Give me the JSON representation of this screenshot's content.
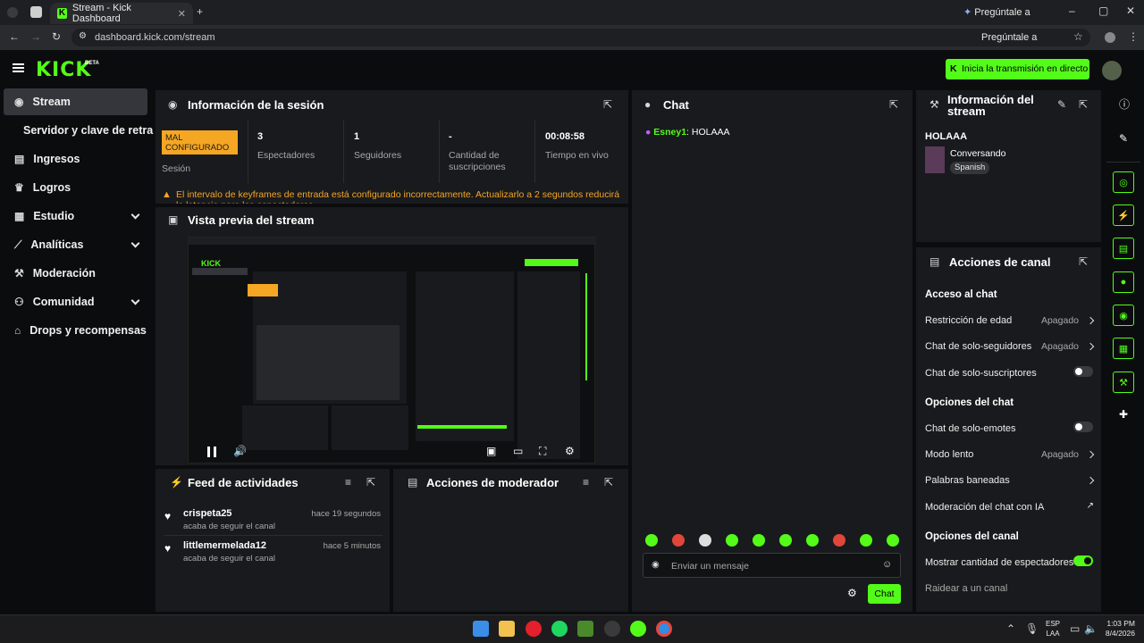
{
  "browser": {
    "tab_title": "Stream - Kick Dashboard",
    "url": "dashboard.kick.com/stream",
    "gemini_label": "Pregúntale a Gemini",
    "google_label": "Pregúntale a Google"
  },
  "header": {
    "logo": "KICK",
    "beta": "BETA",
    "go_live_label": "Inicia la transmisión en directo"
  },
  "sidebar": {
    "items": [
      {
        "label": "Stream"
      },
      {
        "label": "Servidor y clave de retransm"
      },
      {
        "label": "Ingresos"
      },
      {
        "label": "Logros"
      },
      {
        "label": "Estudio"
      },
      {
        "label": "Analíticas"
      },
      {
        "label": "Moderación"
      },
      {
        "label": "Comunidad"
      },
      {
        "label": "Drops y recompensas"
      }
    ]
  },
  "session": {
    "title": "Información de la sesión",
    "status_badge": "MAL CONFIGURADO",
    "status_label": "Sesión",
    "viewers_value": "3",
    "viewers_label": "Espectadores",
    "followers_value": "1",
    "followers_label": "Seguidores",
    "subs_value": "-",
    "subs_label": "Cantidad de suscripciones",
    "uptime_value": "00:08:58",
    "uptime_label": "Tiempo en vivo",
    "warning": "El intervalo de keyframes de entrada está configurado incorrectamente. Actualizarlo a 2 segundos reducirá la latencia para los espectadores."
  },
  "preview": {
    "title": "Vista previa del stream"
  },
  "activity": {
    "title": "Feed de actividades",
    "items": [
      {
        "user": "crispeta25",
        "time": "hace 19 segundos",
        "desc": "acaba de seguir el canal"
      },
      {
        "user": "littlemermelada12",
        "time": "hace 5 minutos",
        "desc": "acaba de seguir el canal"
      }
    ]
  },
  "mod_actions": {
    "title": "Acciones de moderador"
  },
  "chat": {
    "title": "Chat",
    "messages": [
      {
        "user": "Esney1",
        "sep": ":",
        "text": "HOLAAA"
      }
    ],
    "input_placeholder": "Enviar un mensaje",
    "send_label": "Chat"
  },
  "stream_info": {
    "title": "Información del stream",
    "stream_title": "HOLAAA",
    "category": "Conversando",
    "language": "Spanish"
  },
  "channel_actions": {
    "title": "Acciones de canal",
    "chat_access_heading": "Acceso al chat",
    "age_restriction_label": "Restricción de edad",
    "age_restriction_value": "Apagado",
    "followers_only_label": "Chat de solo-seguidores",
    "followers_only_value": "Apagado",
    "subs_only_label": "Chat de solo-suscriptores",
    "chat_options_heading": "Opciones del chat",
    "emotes_only_label": "Chat de solo-emotes",
    "slow_mode_label": "Modo lento",
    "slow_mode_value": "Apagado",
    "banned_words_label": "Palabras baneadas",
    "ai_moderation_label": "Moderación del chat con IA",
    "channel_options_heading": "Opciones del canal",
    "show_viewer_count_label": "Mostrar cantidad de espectadores",
    "raid_label": "Raidear a un canal"
  },
  "taskbar": {
    "lang_top": "ESP",
    "lang_bottom": "LAA",
    "time": "1:03 PM",
    "date": "8/4/2026"
  },
  "colors": {
    "accent": "#53fc18",
    "warning": "#f5a623",
    "badge_bg": "#f5a623",
    "panel_bg": "#191a1d",
    "app_bg": "#0b0c0e"
  }
}
